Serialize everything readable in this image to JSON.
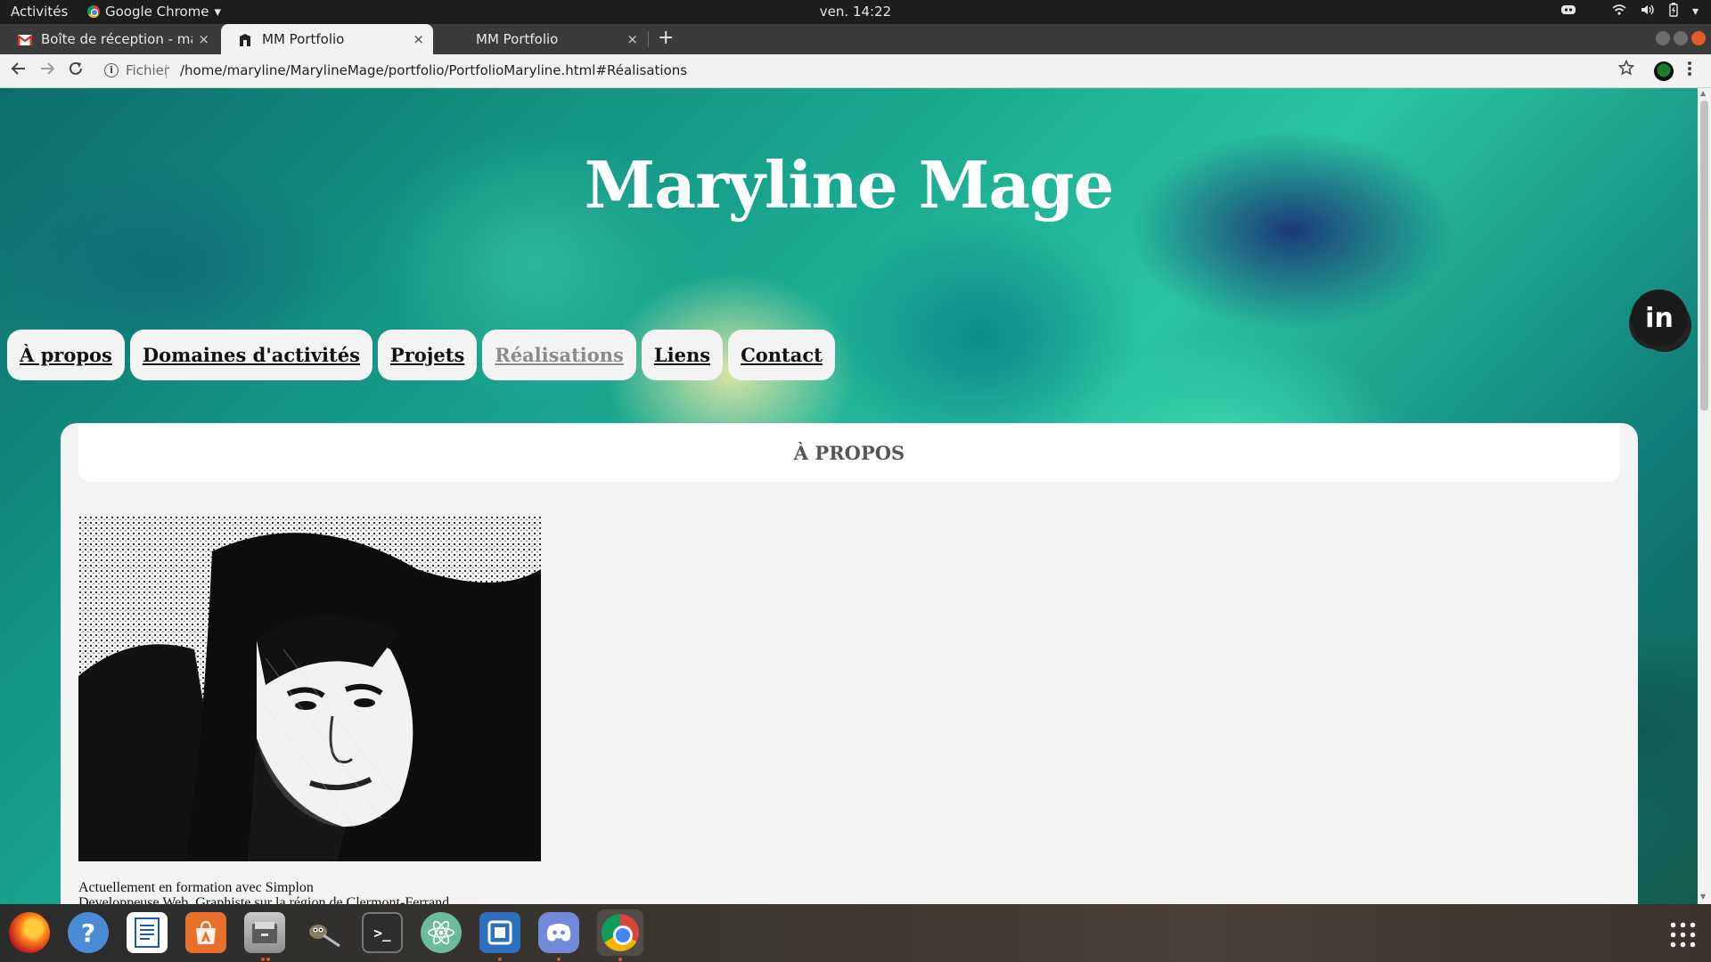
{
  "system_bar": {
    "activities": "Activités",
    "app_name": "Google Chrome",
    "app_caret": "▾",
    "clock": "ven. 14:22"
  },
  "tabs": [
    {
      "title": "Boîte de réception - maryl",
      "favicon": "gmail-icon",
      "active": false
    },
    {
      "title": "MM Portfolio",
      "favicon": "portfolio-favicon",
      "active": true
    },
    {
      "title": "MM Portfolio",
      "favicon": "blank-favicon",
      "active": false
    }
  ],
  "tab_close_glyph": "×",
  "new_tab_glyph": "+",
  "address_bar": {
    "scheme_label": "Fichier",
    "url": "/home/maryline/MarylineMage/portfolio/PortfolioMaryline.html#Réalisations"
  },
  "site": {
    "title": "Maryline Mage",
    "nav": [
      {
        "label": "À propos",
        "visited": false
      },
      {
        "label": "Domaines d'activités",
        "visited": false
      },
      {
        "label": "Projets",
        "visited": false
      },
      {
        "label": "Réalisations",
        "visited": true
      },
      {
        "label": "Liens",
        "visited": false
      },
      {
        "label": "Contact",
        "visited": false
      }
    ],
    "social_badge": "in",
    "section_heading": "À PROPOS",
    "bio_line_1": "Actuellement en formation avec Simplon",
    "bio_line_2": "Developpeuse Web, Graphiste sur la région de Clermont-Ferrand"
  },
  "dock": {
    "items": [
      "firefox-icon",
      "help-icon",
      "writer-icon",
      "software-icon",
      "files-icon",
      "gimp-icon",
      "terminal-icon",
      "atom-icon",
      "code-editor-icon",
      "discord-icon",
      "chrome-icon"
    ],
    "running": [
      "files-icon",
      "code-editor-icon",
      "discord-icon",
      "chrome-icon"
    ]
  },
  "colors": {
    "page_bg_accent": "#18a58d",
    "card_bg": "#f3f3f3",
    "active_tab": "#f2f2f2",
    "visited_link": "#8b8b8b"
  }
}
